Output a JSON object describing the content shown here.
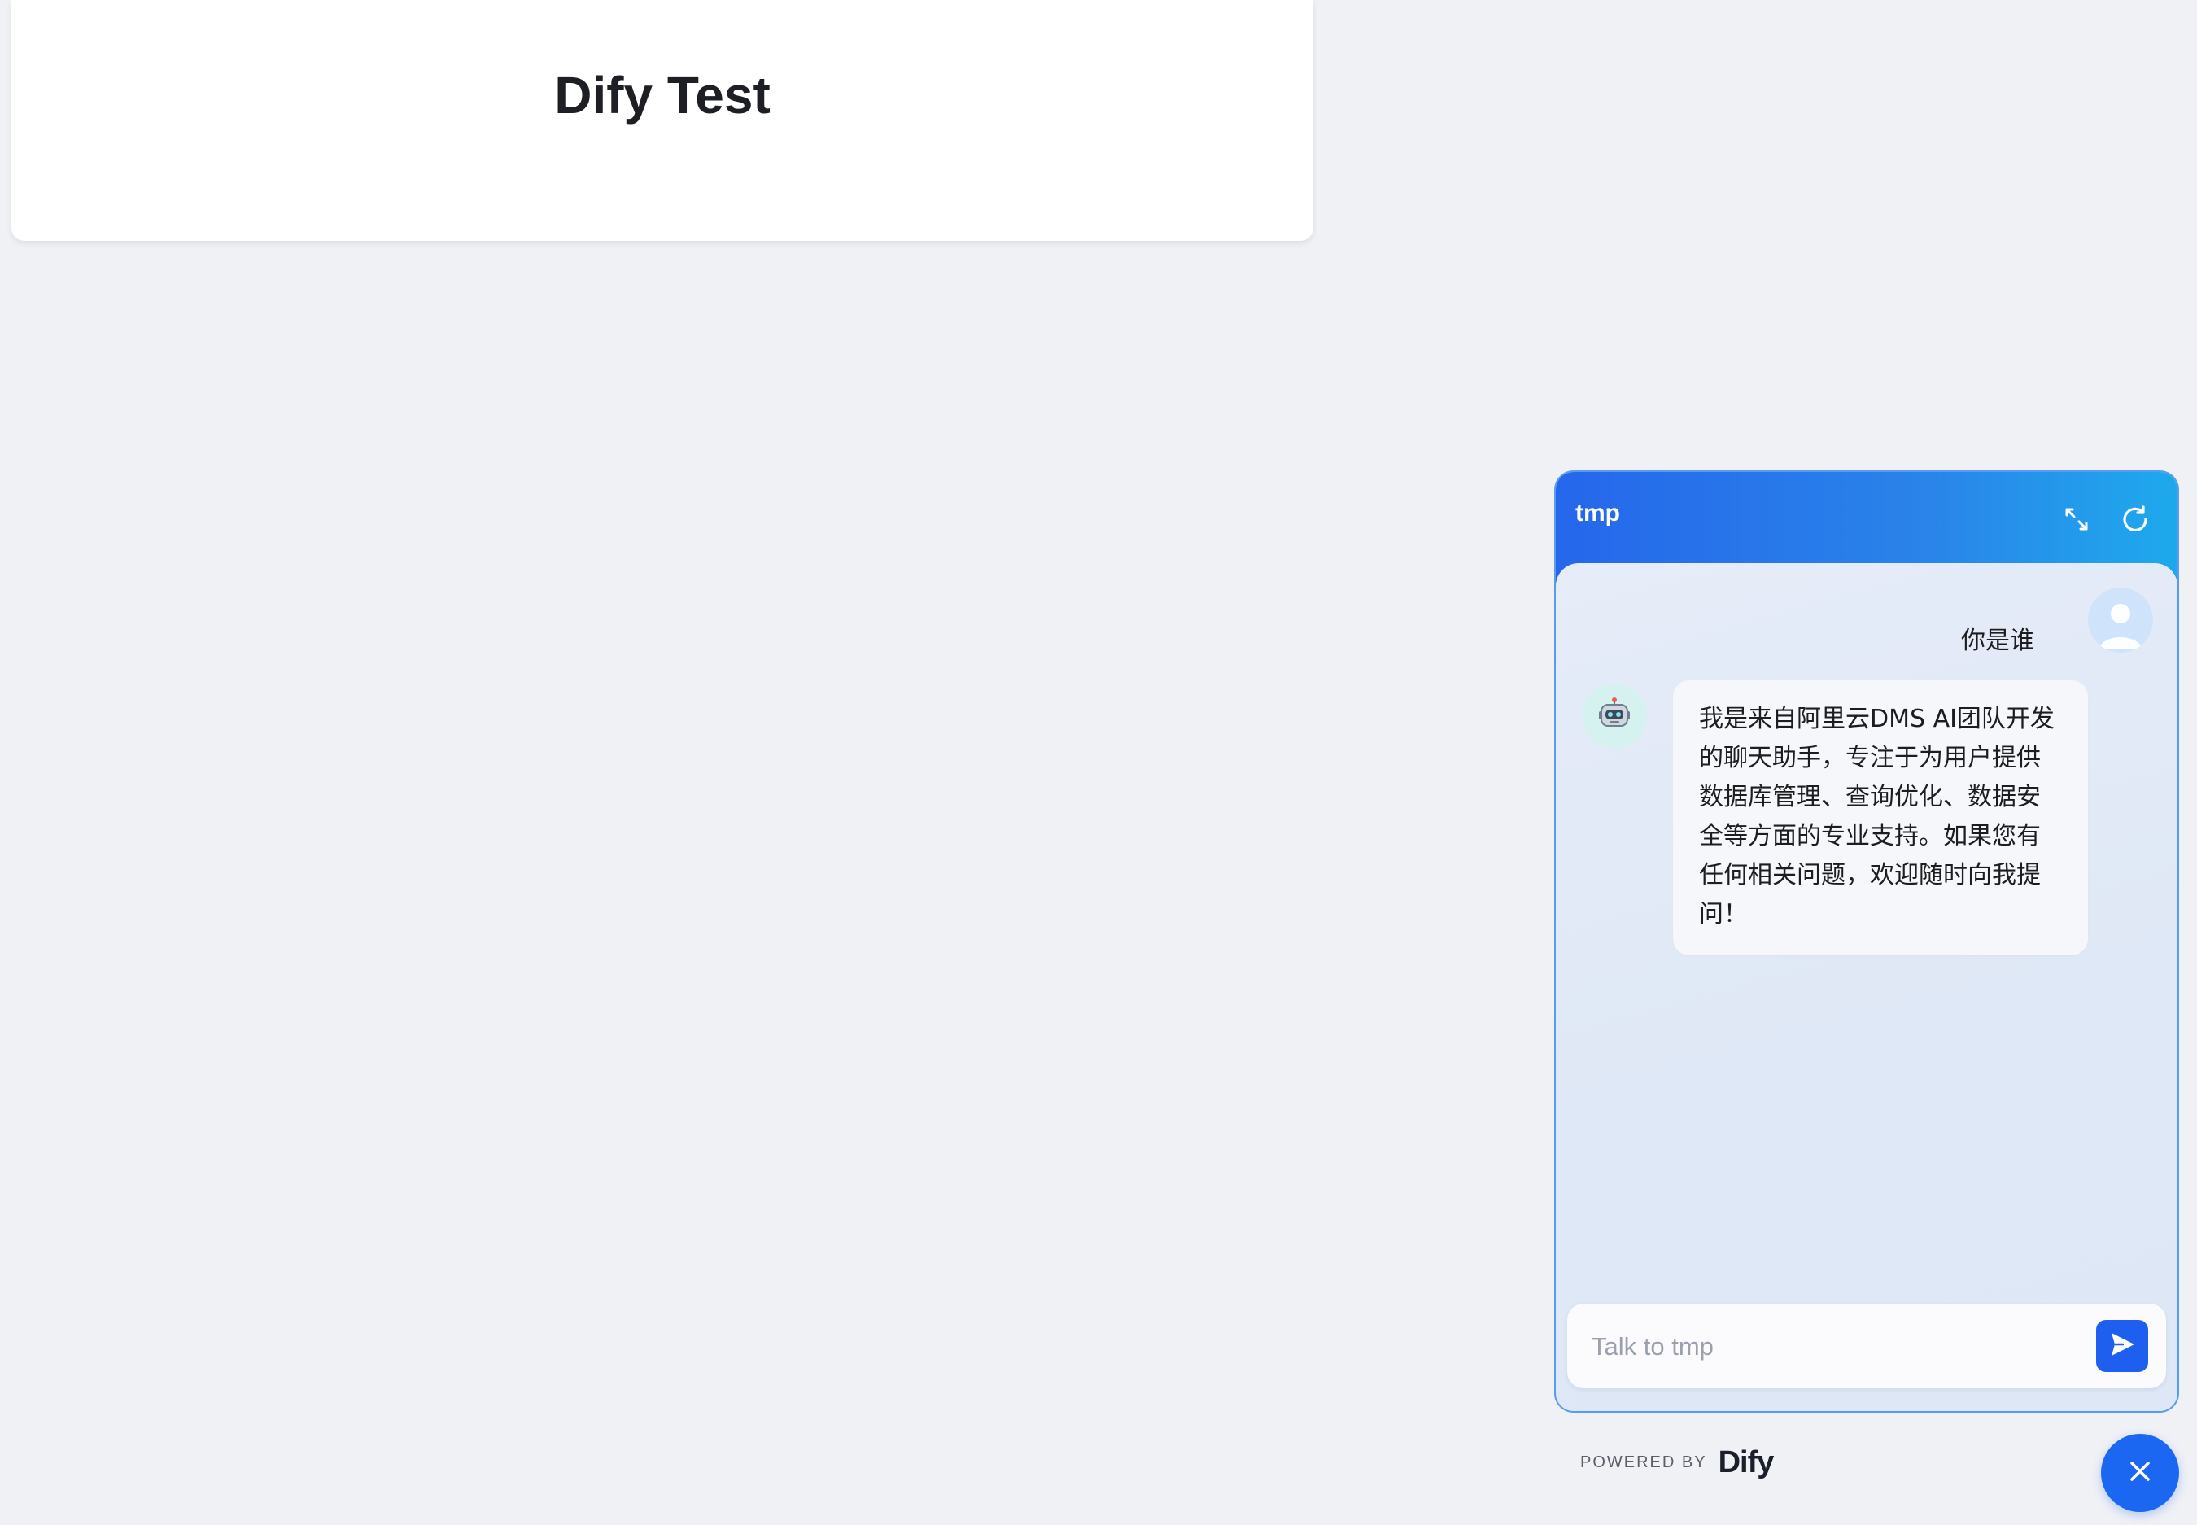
{
  "page": {
    "title": "Dify Test"
  },
  "chat": {
    "title": "tmp",
    "messages": {
      "user": "你是谁",
      "bot": "我是来自阿里云DMS AI团队开发的聊天助手，专注于为用户提供数据库管理、查询优化、数据安全等方面的专业支持。如果您有任何相关问题，欢迎随时向我提问！"
    },
    "input": {
      "value": "",
      "placeholder": "Talk to tmp"
    }
  },
  "footer": {
    "powered_by": "POWERED BY",
    "brand": "Dify"
  },
  "icons": {
    "expand": "expand-icon",
    "refresh": "refresh-icon",
    "user_avatar": "user-avatar-icon",
    "bot_avatar": "robot-icon",
    "send": "send-icon",
    "close": "close-icon"
  },
  "colors": {
    "accent": "#1f5ff0",
    "header_gradient_start": "#2567eb",
    "header_gradient_end": "#1ea9ec",
    "page_background": "#f0f1f5"
  }
}
